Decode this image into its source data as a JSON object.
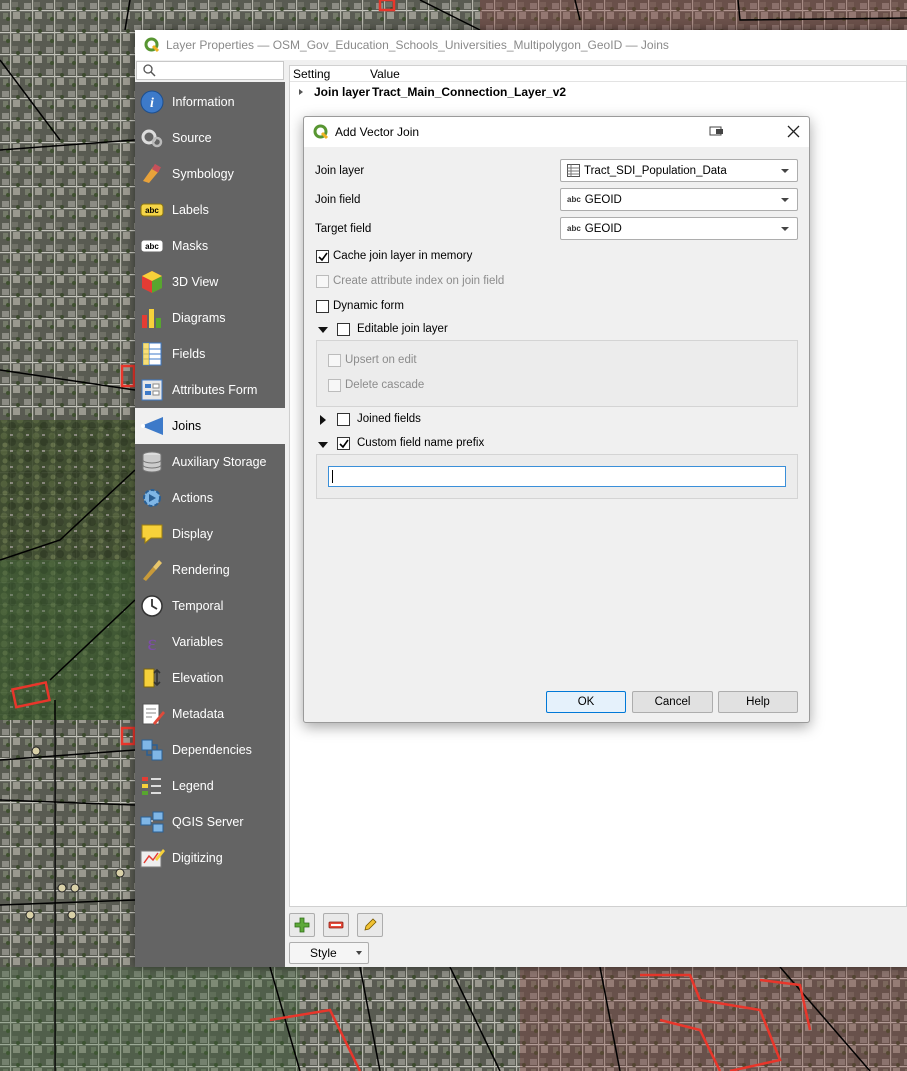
{
  "window": {
    "title": "Layer Properties — OSM_Gov_Education_Schools_Universities_Multipolygon_GeoID — Joins"
  },
  "sidebar": {
    "items": [
      {
        "label": "Information",
        "icon": "information-icon"
      },
      {
        "label": "Source",
        "icon": "source-icon"
      },
      {
        "label": "Symbology",
        "icon": "symbology-icon"
      },
      {
        "label": "Labels",
        "icon": "labels-icon"
      },
      {
        "label": "Masks",
        "icon": "masks-icon"
      },
      {
        "label": "3D View",
        "icon": "3d-view-icon"
      },
      {
        "label": "Diagrams",
        "icon": "diagrams-icon"
      },
      {
        "label": "Fields",
        "icon": "fields-icon"
      },
      {
        "label": "Attributes Form",
        "icon": "attributes-form-icon"
      },
      {
        "label": "Joins",
        "icon": "joins-icon",
        "selected": true
      },
      {
        "label": "Auxiliary Storage",
        "icon": "auxiliary-storage-icon"
      },
      {
        "label": "Actions",
        "icon": "actions-icon"
      },
      {
        "label": "Display",
        "icon": "display-icon"
      },
      {
        "label": "Rendering",
        "icon": "rendering-icon"
      },
      {
        "label": "Temporal",
        "icon": "temporal-icon"
      },
      {
        "label": "Variables",
        "icon": "variables-icon"
      },
      {
        "label": "Elevation",
        "icon": "elevation-icon"
      },
      {
        "label": "Metadata",
        "icon": "metadata-icon"
      },
      {
        "label": "Dependencies",
        "icon": "dependencies-icon"
      },
      {
        "label": "Legend",
        "icon": "legend-icon"
      },
      {
        "label": "QGIS Server",
        "icon": "qgis-server-icon"
      },
      {
        "label": "Digitizing",
        "icon": "digitizing-icon"
      }
    ]
  },
  "joins_tree": {
    "columns": [
      "Setting",
      "Value"
    ],
    "rows": [
      {
        "setting": "Join layer",
        "value": "Tract_Main_Connection_Layer_v2"
      }
    ]
  },
  "toolbar": {
    "style_label": "Style"
  },
  "dialog": {
    "title": "Add Vector Join",
    "join_layer_label": "Join layer",
    "join_layer_value": "Tract_SDI_Population_Data",
    "join_field_label": "Join field",
    "join_field_value": "GEOID",
    "target_field_label": "Target field",
    "target_field_value": "GEOID",
    "field_type_tag": "abc",
    "cache_label": "Cache join layer in memory",
    "cache_checked": true,
    "attr_index_label": "Create attribute index on join field",
    "dynamic_form_label": "Dynamic form",
    "editable_label": "Editable join layer",
    "upsert_label": "Upsert on edit",
    "delete_cascade_label": "Delete cascade",
    "joined_fields_label": "Joined fields",
    "prefix_label": "Custom field name prefix",
    "prefix_checked": true,
    "prefix_value": "",
    "ok_label": "OK",
    "cancel_label": "Cancel",
    "help_label": "Help"
  },
  "colors": {
    "accent": "#0078d7",
    "qgis_green": "#589632",
    "sidebar_bg": "#646464",
    "map_boundary": "#e8362b"
  }
}
